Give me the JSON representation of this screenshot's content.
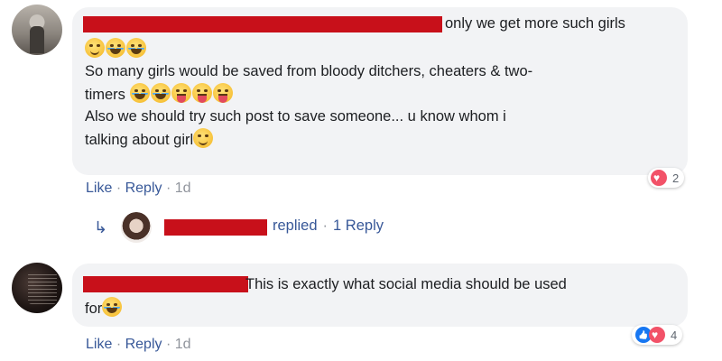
{
  "comment1": {
    "line1_tail": "only we get more such girls",
    "line3": "So many girls would be saved from bloody ditchers, cheaters & two-",
    "line4": "timers",
    "line5": "Also we should try such post to save someone... u know whom i",
    "line6": "talking about girl",
    "actions": {
      "like": "Like",
      "reply": "Reply",
      "time": "1d"
    },
    "reaction_count": "2"
  },
  "reply_summary": {
    "replied": "replied",
    "count": "1 Reply"
  },
  "comment2": {
    "line1_tail": "This is exactly what social media should be used",
    "line2": "for",
    "actions": {
      "like": "Like",
      "reply": "Reply",
      "time": "1d"
    },
    "reaction_count": "4"
  },
  "separator": "·",
  "colors": {
    "link": "#385898",
    "redaction": "#c8101a",
    "bubble": "#f2f3f5"
  }
}
